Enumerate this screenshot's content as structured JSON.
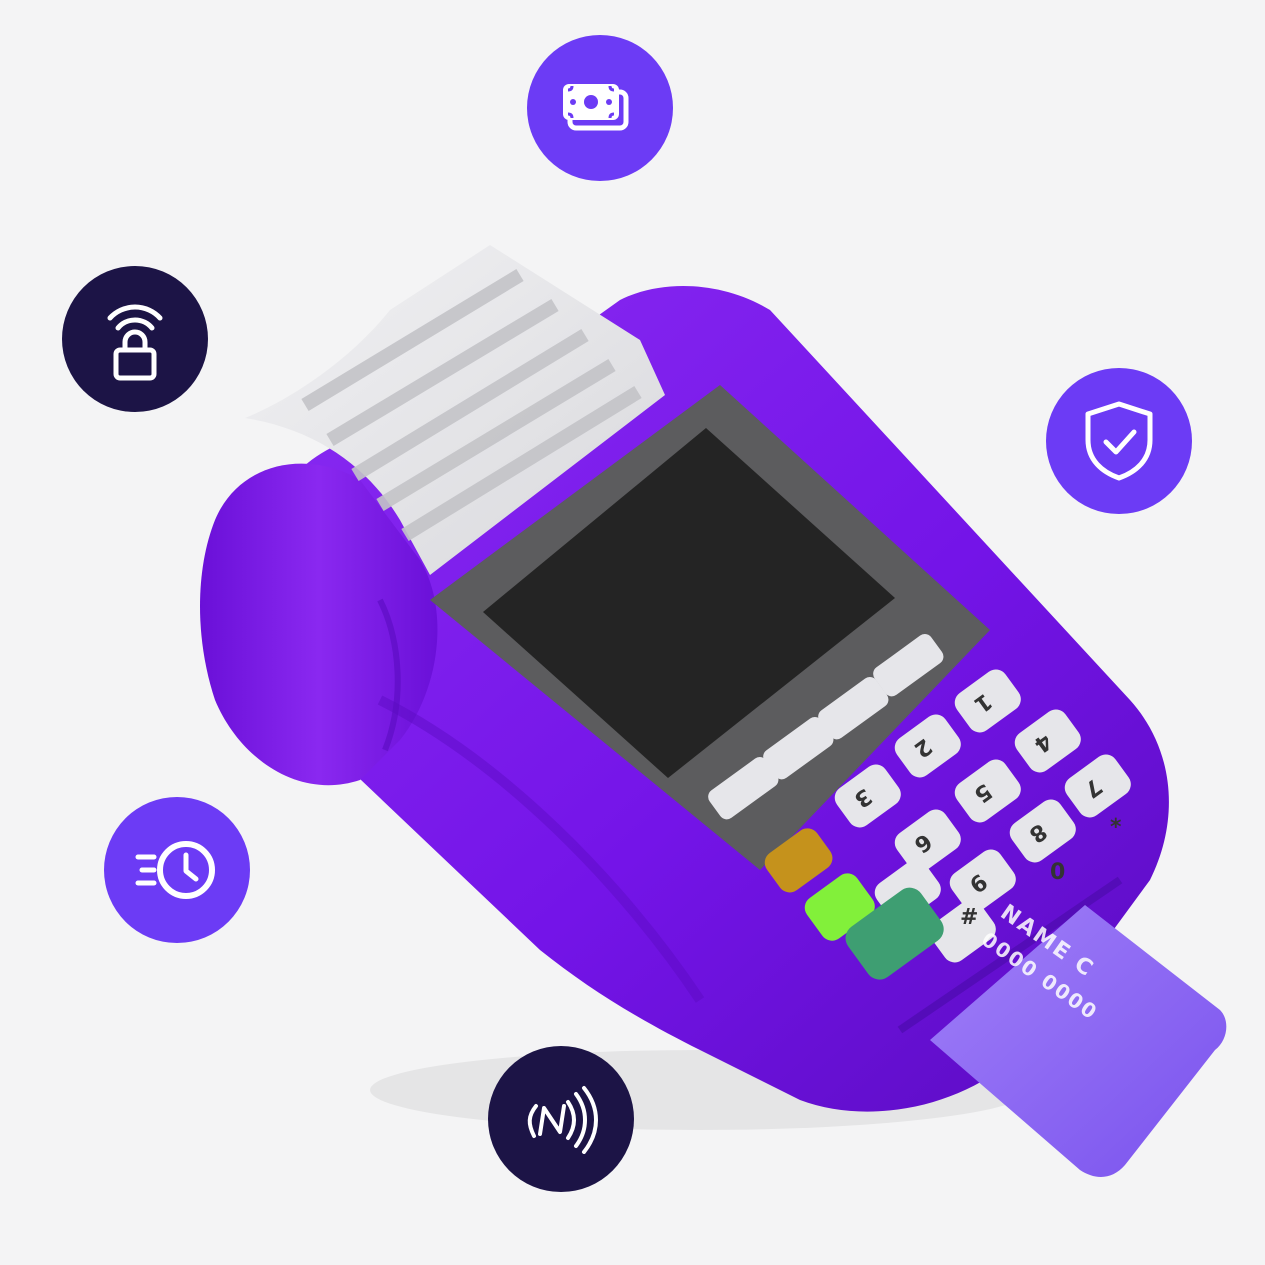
{
  "colors": {
    "background": "#f4f4f5",
    "accent_purple": "#6c3bf5",
    "dark_navy": "#1c1446",
    "terminal_body": "#7414e8",
    "terminal_dark": "#5a0cc0",
    "card": "#9670f5",
    "key": "#e6e6ea",
    "screen": "#242424",
    "bezel": "#5c5c5e",
    "key_amber": "#c5921c",
    "key_lime": "#82f03a",
    "key_green": "#3e9e72"
  },
  "icons": {
    "money": "money-icon",
    "lock": "wireless-lock-icon",
    "shield": "shield-check-icon",
    "clock": "fast-clock-icon",
    "nfc": "nfc-icon"
  },
  "card": {
    "line1": "NAME C",
    "line2": "0000 0000"
  },
  "keypad": {
    "keys": [
      "1",
      "2",
      "3",
      "4",
      "5",
      "6",
      "7",
      "8",
      "9",
      "*",
      "0",
      "#"
    ]
  }
}
